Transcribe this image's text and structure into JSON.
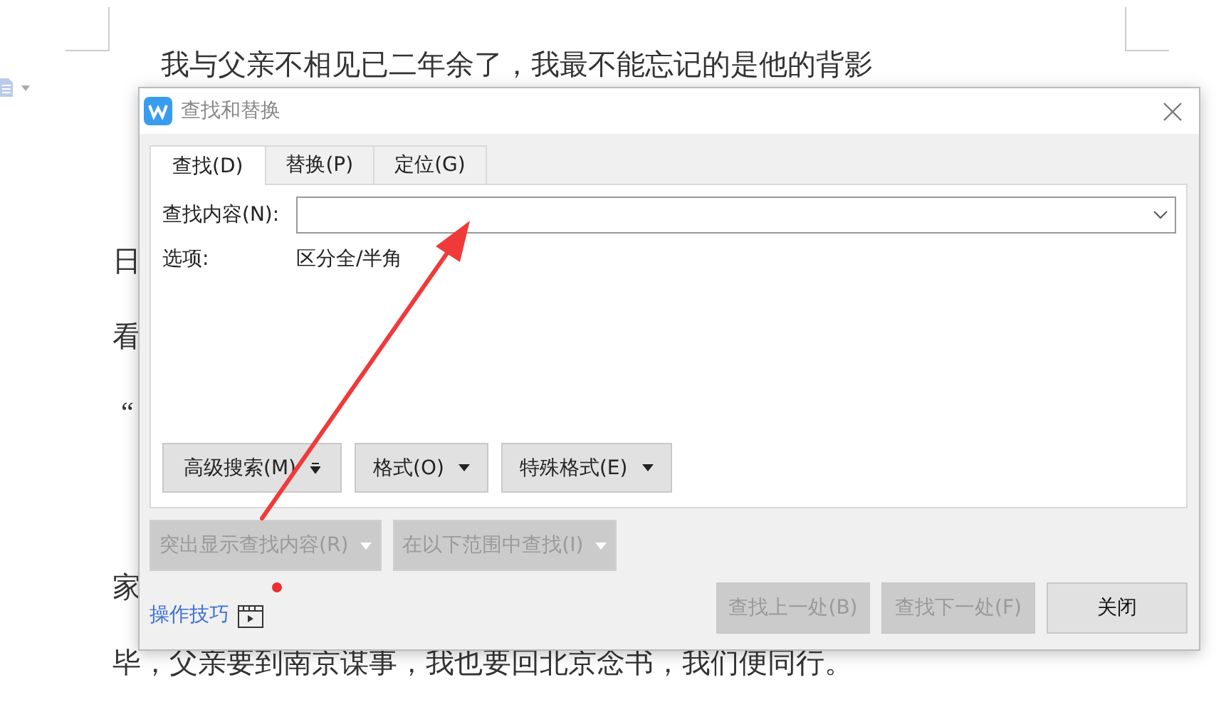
{
  "document": {
    "lines": [
      {
        "text": "我与父亲不相见已二年余了，我最不能忘记的是他的背影"
      },
      {
        "text": "日"
      },
      {
        "text": "看"
      },
      {
        "text": "“"
      },
      {
        "text": "家"
      },
      {
        "text": "毕，父亲要到南京谋事，我也要回北京念书，我们便同行。"
      }
    ]
  },
  "dialog": {
    "title": "查找和替换",
    "tabs": [
      {
        "label": "查找(D)",
        "selected": true
      },
      {
        "label": "替换(P)",
        "selected": false
      },
      {
        "label": "定位(G)",
        "selected": false
      }
    ],
    "find_label": "查找内容(N):",
    "options_label": "选项:",
    "options_value": "区分全/半角",
    "format_buttons": [
      {
        "label": "高级搜索(M)",
        "kind": "double-caret"
      },
      {
        "label": "格式(O)",
        "kind": "caret"
      },
      {
        "label": "特殊格式(E)",
        "kind": "caret"
      }
    ],
    "range_buttons": [
      {
        "label": "突出显示查找内容(R)",
        "disabled": true
      },
      {
        "label": "在以下范围中查找(I)",
        "disabled": true
      }
    ],
    "tips_link": "操作技巧",
    "tips_badge": true,
    "action_buttons": [
      {
        "label": "查找上一处(B)",
        "disabled": true
      },
      {
        "label": "查找下一处(F)",
        "disabled": true
      },
      {
        "label": "关闭",
        "disabled": false
      }
    ]
  },
  "annotation": {
    "kind": "arrow"
  }
}
